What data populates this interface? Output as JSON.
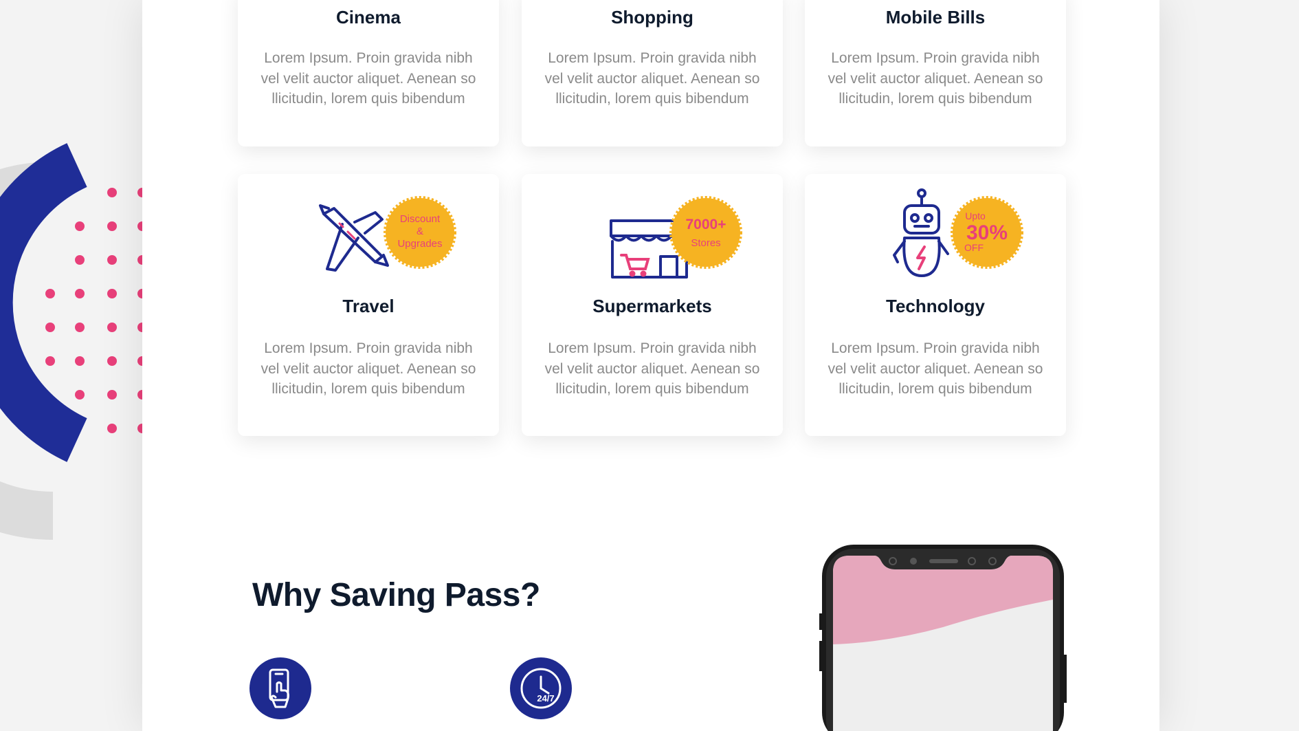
{
  "cards": [
    {
      "title": "Cinema",
      "desc": "Lorem Ipsum. Proin gravida nibh vel velit auctor aliquet. Aenean so llicitudin, lorem quis bibendum"
    },
    {
      "title": "Shopping",
      "desc": "Lorem Ipsum. Proin gravida nibh vel velit auctor aliquet. Aenean so llicitudin, lorem quis bibendum"
    },
    {
      "title": "Mobile Bills",
      "desc": "Lorem Ipsum. Proin gravida nibh vel velit auctor aliquet. Aenean so llicitudin, lorem quis bibendum"
    },
    {
      "title": "Travel",
      "desc": "Lorem Ipsum. Proin gravida nibh vel velit auctor aliquet. Aenean so llicitudin, lorem quis bibendum",
      "icon": "airplane-icon",
      "badge": [
        "Discount",
        "&",
        "Upgrades"
      ]
    },
    {
      "title": "Supermarkets",
      "desc": "Lorem Ipsum. Proin gravida nibh vel velit auctor aliquet. Aenean so llicitudin, lorem quis bibendum",
      "icon": "store-icon",
      "badge": [
        "7000+",
        "Stores"
      ]
    },
    {
      "title": "Technology",
      "desc": "Lorem Ipsum. Proin gravida nibh vel velit auctor aliquet. Aenean so llicitudin, lorem quis bibendum",
      "icon": "robot-icon",
      "badge": [
        "Upto",
        "30%",
        "OFF"
      ]
    }
  ],
  "section": {
    "heading": "Why Saving Pass?"
  },
  "features": [
    {
      "icon": "phone-tap-icon"
    },
    {
      "icon": "clock-24-7-icon"
    }
  ],
  "colors": {
    "navy": "#1e2a8f",
    "pink": "#e8407a",
    "badge": "#f6b322",
    "phone_pink": "#e6a7bc"
  }
}
